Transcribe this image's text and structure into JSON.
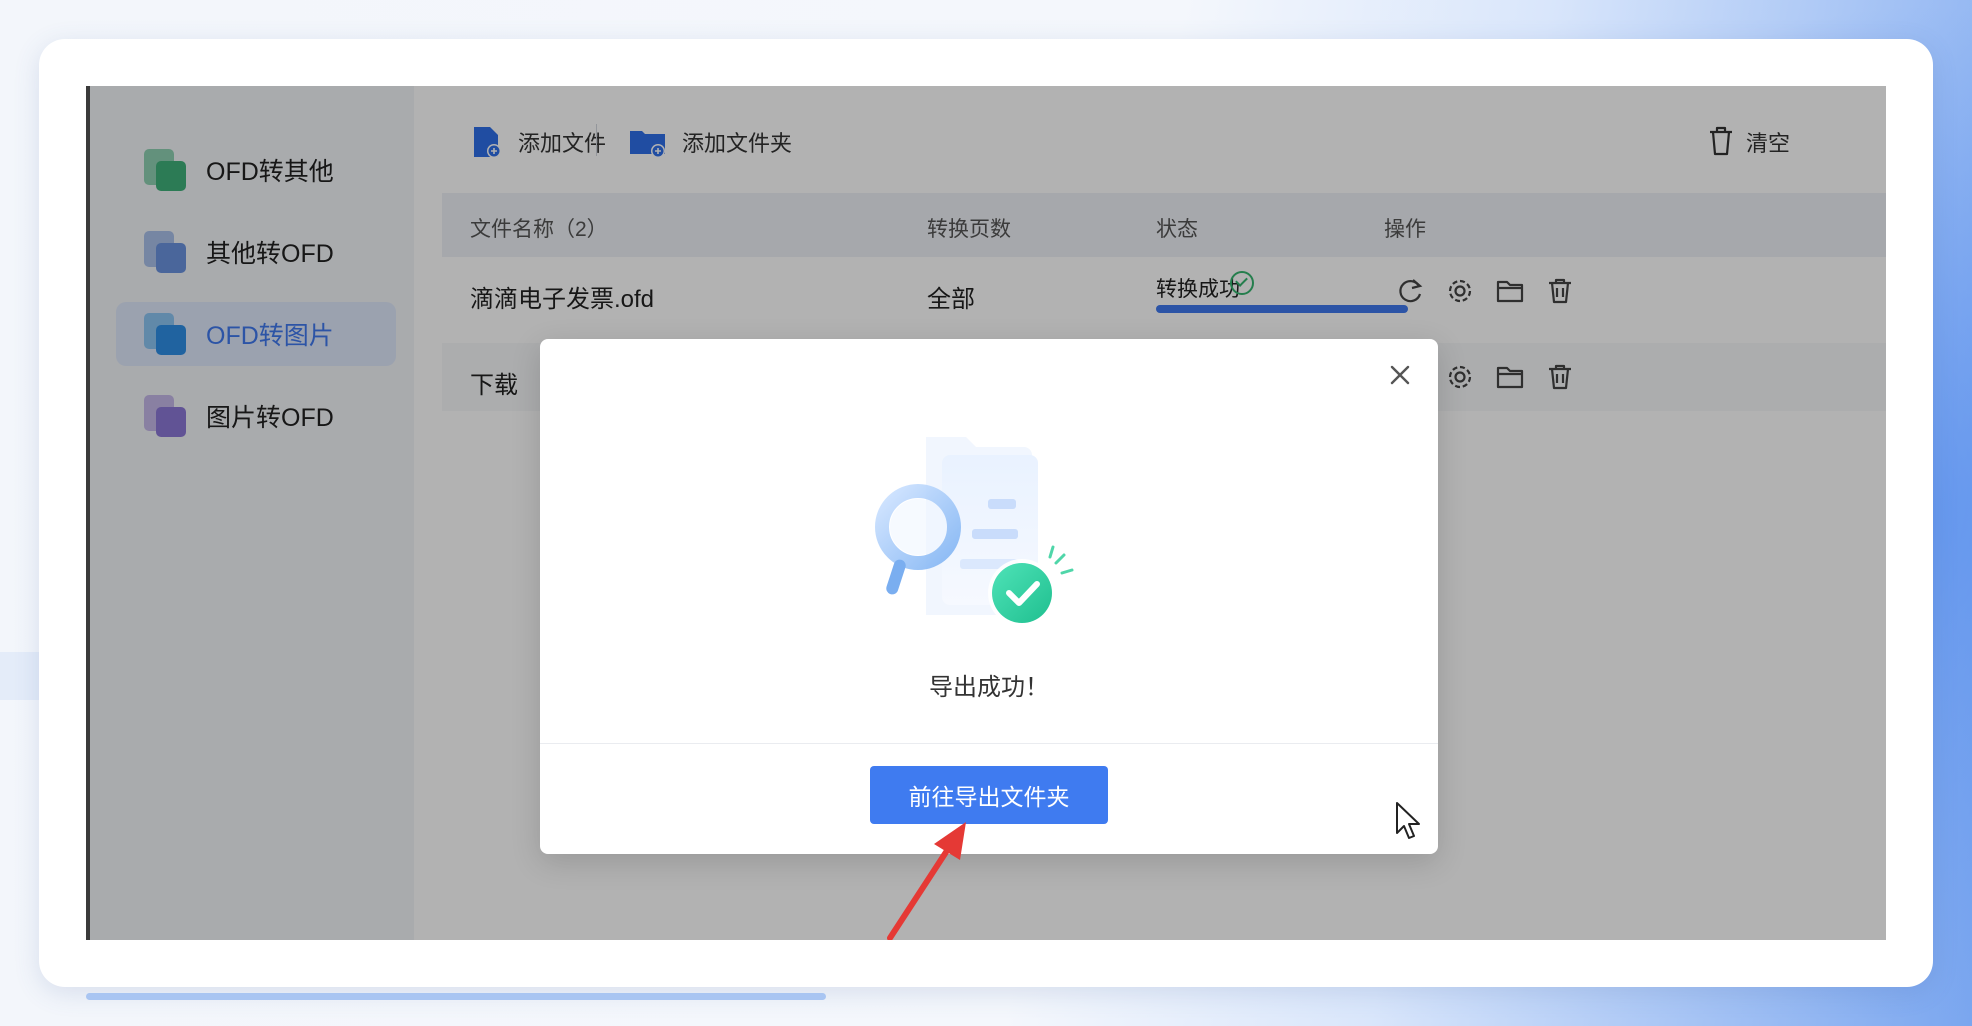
{
  "sidebar": {
    "items": [
      {
        "label": "OFD转其他",
        "icon": "ofd-to-other-icon",
        "active": false
      },
      {
        "label": "其他转OFD",
        "icon": "other-to-ofd-icon",
        "active": false
      },
      {
        "label": "OFD转图片",
        "icon": "ofd-to-image-icon",
        "active": true
      },
      {
        "label": "图片转OFD",
        "icon": "image-to-ofd-icon",
        "active": false
      }
    ]
  },
  "toolbar": {
    "add_file": "添加文件",
    "add_folder": "添加文件夹",
    "clear": "清空"
  },
  "table": {
    "columns": {
      "name": "文件名称（2）",
      "pages": "转换页数",
      "status": "状态",
      "actions": "操作"
    },
    "rows": [
      {
        "name": "滴滴电子发票.ofd",
        "pages": "全部",
        "status": "转换成功",
        "progress": 1.0
      },
      {
        "name": "下载",
        "pages": "",
        "status": "",
        "progress": 1.0
      }
    ]
  },
  "modal": {
    "message": "导出成功！",
    "button": "前往导出文件夹"
  },
  "colors": {
    "accent": "#3f7bf0",
    "success": "#35b56f",
    "overlay": "rgba(0,0,0,0.30)"
  }
}
